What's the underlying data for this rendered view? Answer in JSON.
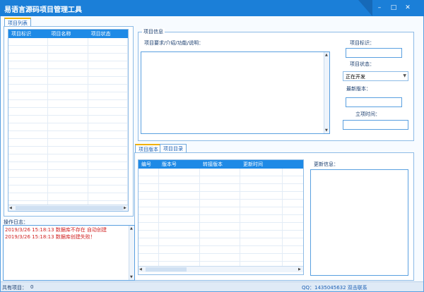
{
  "window": {
    "title": "易语言源码项目管理工具",
    "controls": {
      "minimize": "–",
      "restore": "□",
      "close": "✕"
    },
    "title_color": "#1b7fd8"
  },
  "project_list": {
    "tab_label": "项目列表",
    "columns": [
      "项目标识",
      "项目名称",
      "项目状态"
    ],
    "rows": []
  },
  "project_info": {
    "group_label": "项目信息",
    "desc_label": "项目要求/介绍/功能/说明：",
    "id_label": "项目标识：",
    "id_value": "",
    "status_label": "项目状态：",
    "status_value": "正在开发",
    "version_label": "最新版本：",
    "version_value": "",
    "created_label": "立项时间：",
    "created_value": ""
  },
  "lower_tabs": [
    "项目版本",
    "项目目录"
  ],
  "version_grid": {
    "columns": [
      "编号",
      "版本号",
      "转接版本",
      "更新时间"
    ],
    "rows": []
  },
  "update_info": {
    "label": "更新信息：",
    "value": ""
  },
  "log": {
    "label": "操作日志：",
    "entries": [
      "2019/3/26 15:18:13    数据库不存在 自动创建",
      "2019/3/26 15:18:13    数据库创建失败！"
    ],
    "color": "#d02020"
  },
  "status_bar": {
    "project_count_label": "共有项目：",
    "project_count": "0",
    "contact": "QQ：1435045632 双击联系"
  }
}
